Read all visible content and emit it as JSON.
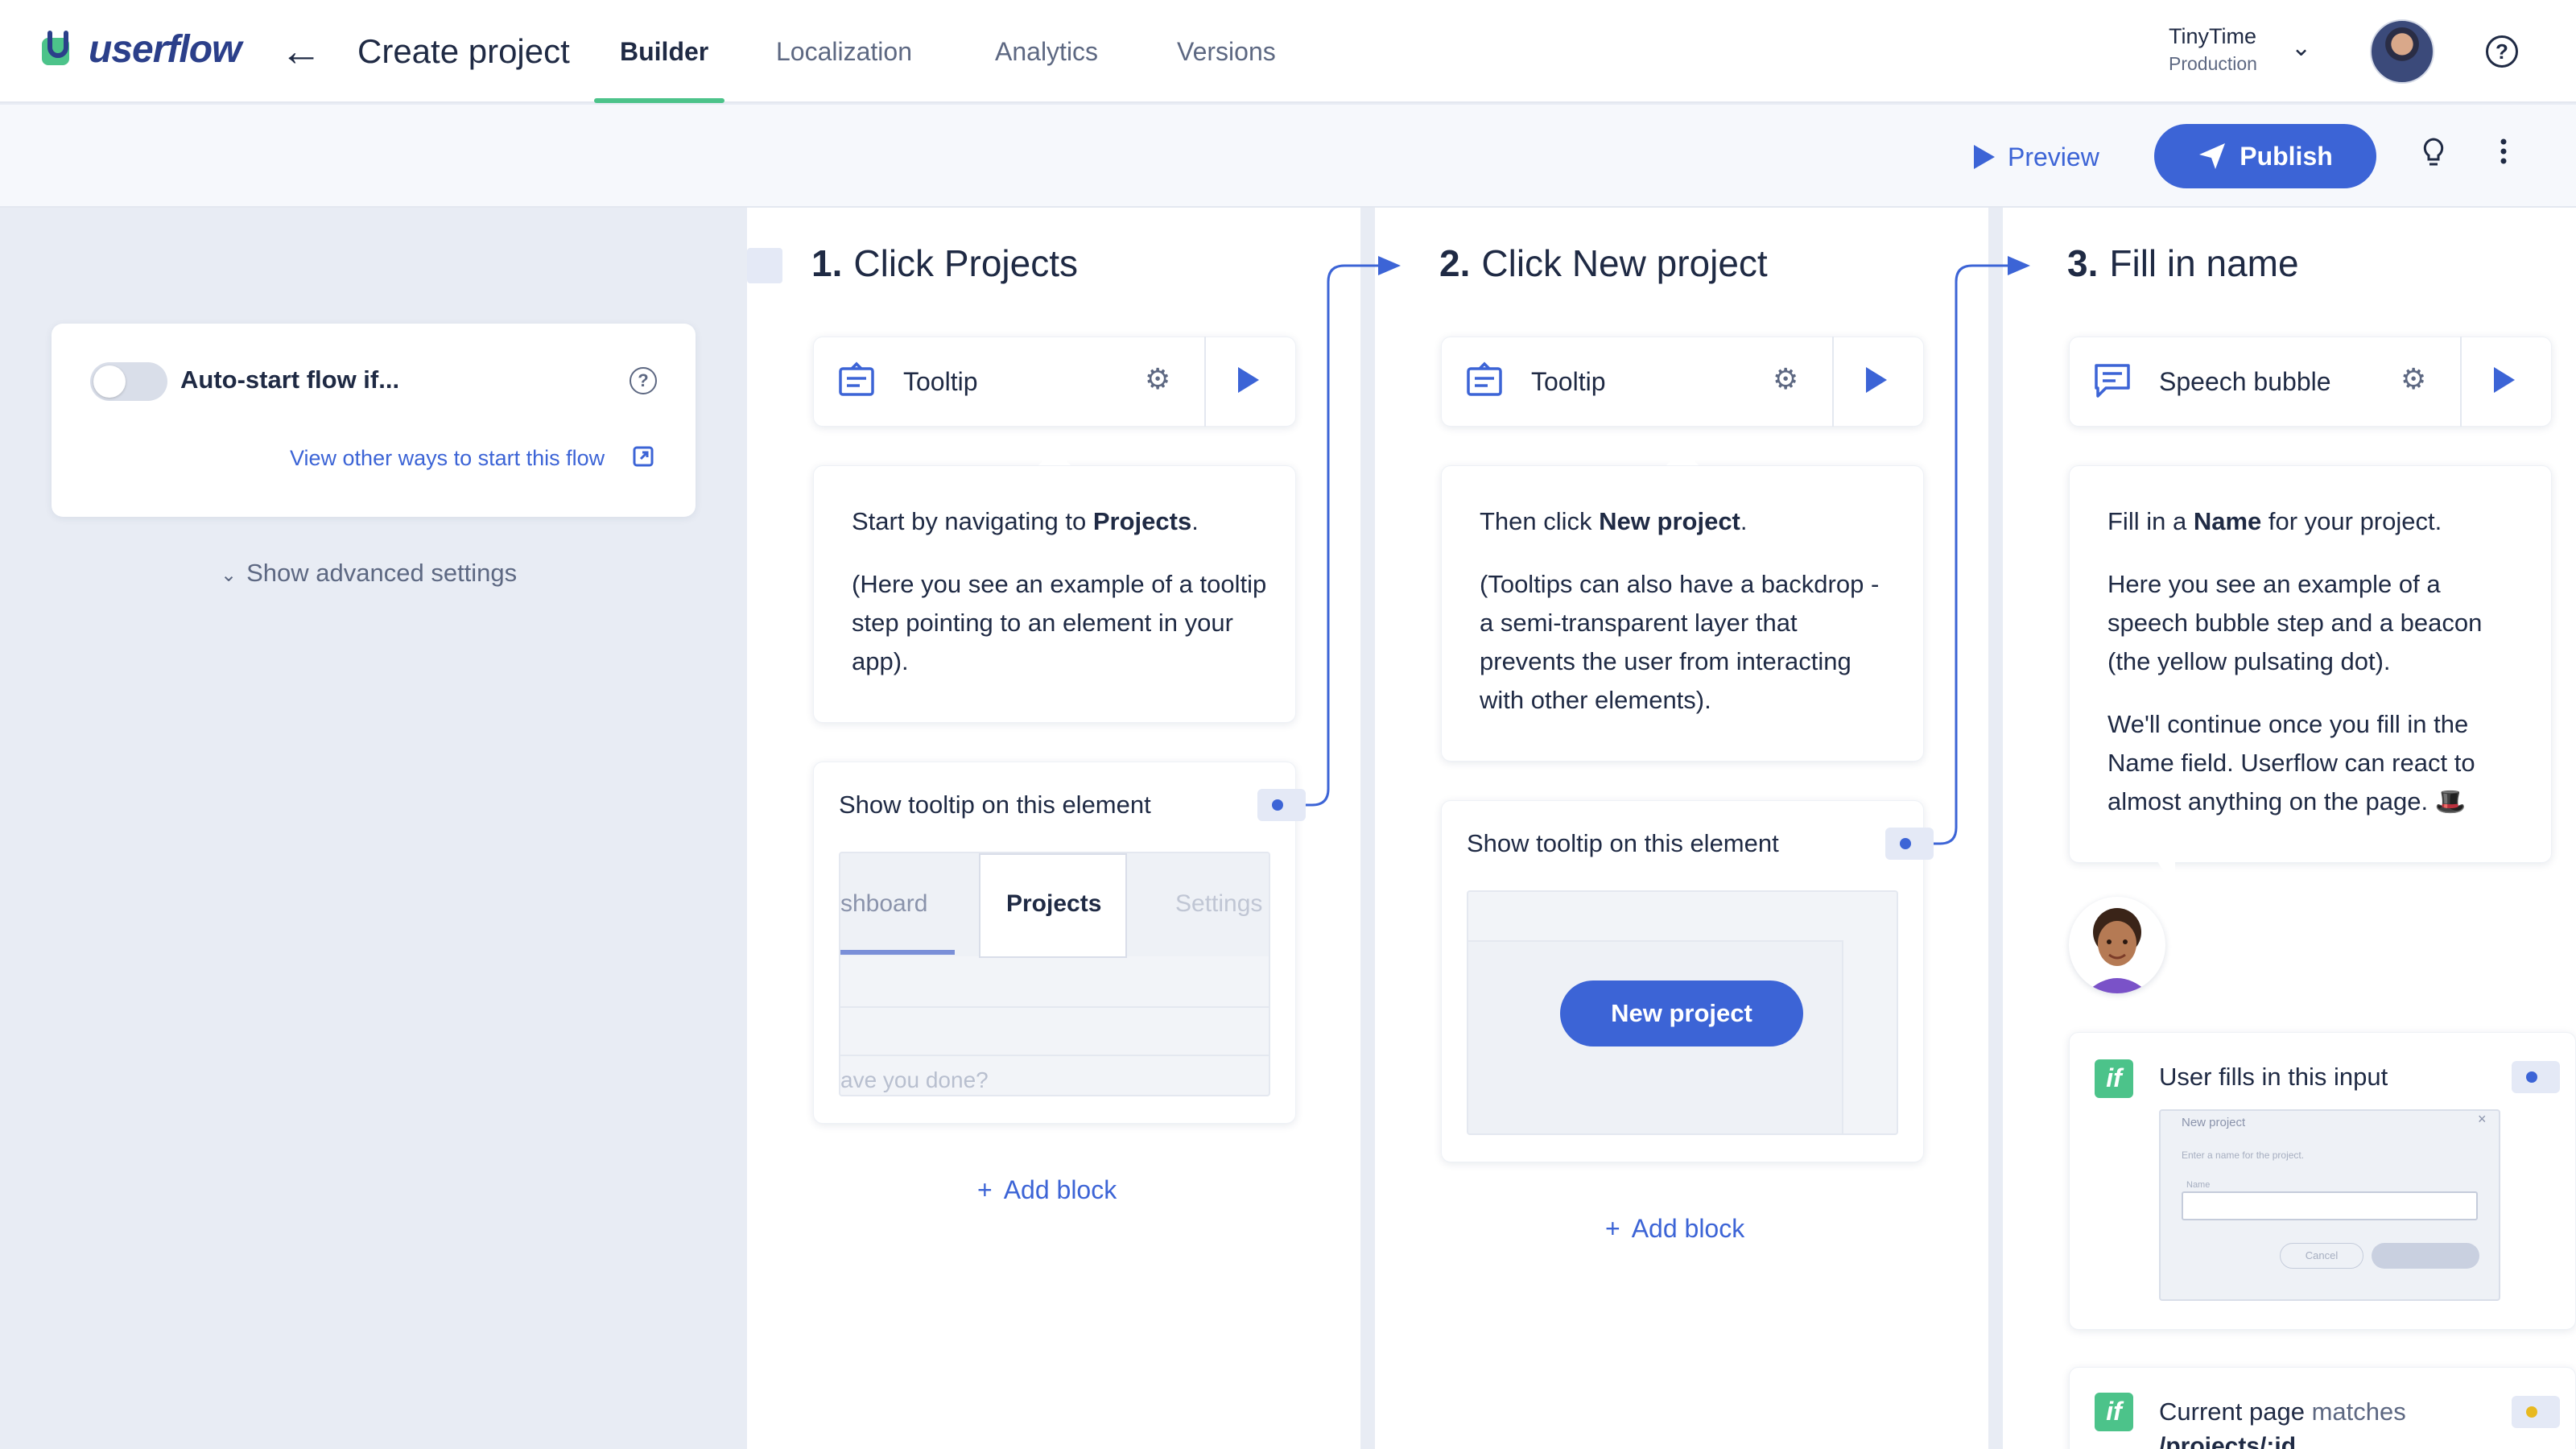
{
  "app": {
    "brand": "userflow",
    "page_title": "Create project"
  },
  "nav": {
    "tabs": [
      {
        "label": "Builder",
        "active": true
      },
      {
        "label": "Localization",
        "active": false
      },
      {
        "label": "Analytics",
        "active": false
      },
      {
        "label": "Versions",
        "active": false
      }
    ],
    "org_name": "TinyTime",
    "org_env": "Production"
  },
  "toolbar": {
    "preview_label": "Preview",
    "publish_label": "Publish"
  },
  "start_settings": {
    "autostart_label": "Auto-start flow if...",
    "other_ways_link": "View other ways to start this flow",
    "advanced_label": "Show advanced settings"
  },
  "steps": [
    {
      "number": "1.",
      "title": "Click Projects",
      "block_type": "Tooltip",
      "content": [
        {
          "before": "Start by navigating to ",
          "bold": "Projects",
          "after": "."
        },
        {
          "before": "(Here you see an example of a tooltip step pointing to an element in your app).",
          "bold": "",
          "after": ""
        }
      ],
      "target_label": "Show tooltip on this element",
      "preview_tabs": [
        "shboard",
        "Projects",
        "Settings"
      ],
      "preview_placeholder": "ave you done?",
      "add_block": "Add block"
    },
    {
      "number": "2.",
      "title": "Click New project",
      "block_type": "Tooltip",
      "content": [
        {
          "before": "Then click ",
          "bold": "New project",
          "after": "."
        },
        {
          "before": "(Tooltips can also have a backdrop - a semi-transparent layer that prevents the user from interacting with other elements).",
          "bold": "",
          "after": ""
        }
      ],
      "target_label": "Show tooltip on this element",
      "preview_button": "New project",
      "add_block": "Add block"
    },
    {
      "number": "3.",
      "title": "Fill in name",
      "block_type": "Speech bubble",
      "content": [
        {
          "before": "Fill in a ",
          "bold": "Name",
          "after": " for your project."
        },
        {
          "before": "Here you see an example of a speech bubble step and a beacon (the yellow pulsating dot).",
          "bold": "",
          "after": ""
        },
        {
          "before": "We'll continue once you fill in the Name field. Userflow can react to almost anything on the page. 🎩",
          "bold": "",
          "after": ""
        }
      ],
      "conditions": [
        {
          "badge": "if",
          "label": "User fills in this input",
          "preview_title": "New project",
          "preview_hint": "Enter a name for the project.",
          "preview_field": "Name",
          "preview_cancel": "Cancel"
        },
        {
          "badge": "if",
          "label_plain": "Current page",
          "label_muted": "matches",
          "label_code": "/projects/:id"
        }
      ]
    }
  ],
  "colors": {
    "accent": "#3c64d6",
    "brand_green": "#4cc38a",
    "condition_green": "#4cc38a",
    "beacon_yellow": "#e8b920"
  }
}
